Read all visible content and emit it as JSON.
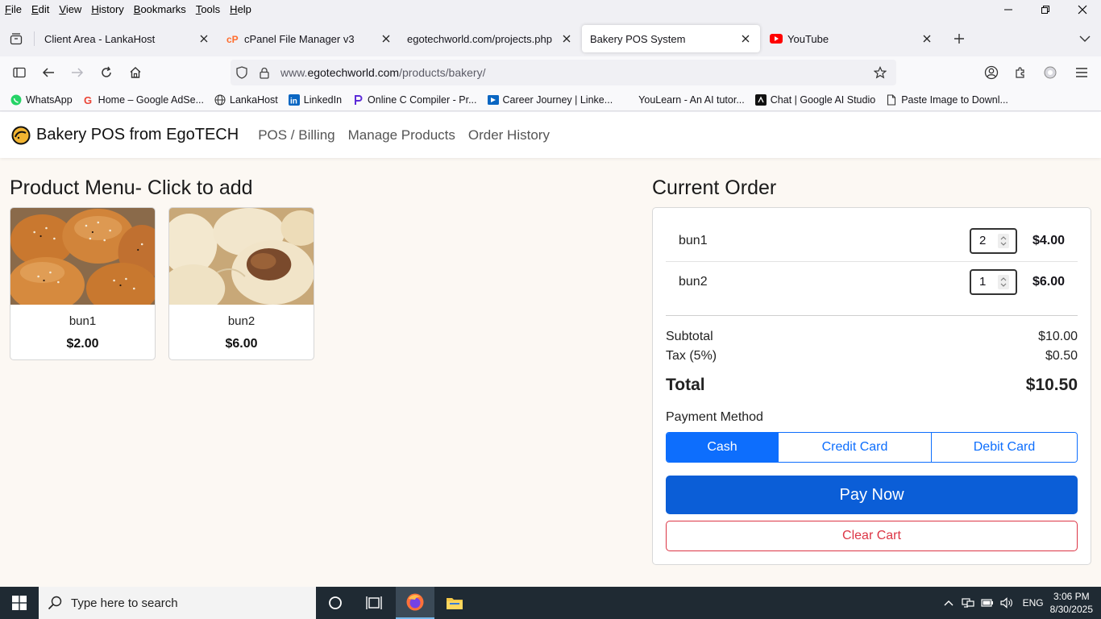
{
  "menubar": {
    "items": [
      "File",
      "Edit",
      "View",
      "History",
      "Bookmarks",
      "Tools",
      "Help"
    ],
    "underline": [
      "F",
      "E",
      "V",
      "H",
      "B",
      "T",
      "H"
    ]
  },
  "tabs": [
    {
      "title": "Client Area - LankaHost",
      "icon": "lankahost-icon"
    },
    {
      "title": "cPanel File Manager v3",
      "icon": "cpanel-icon"
    },
    {
      "title": "egotechworld.com/projects.php",
      "icon": ""
    },
    {
      "title": "Bakery POS System",
      "icon": "",
      "active": true
    },
    {
      "title": "YouTube",
      "icon": "youtube-icon"
    }
  ],
  "urlbar": {
    "prefix": "www.",
    "host": "egotechworld.com",
    "path": "/products/bakery/"
  },
  "bookmarks": [
    {
      "label": "WhatsApp",
      "icon": "whatsapp-icon"
    },
    {
      "label": "Home – Google AdSe...",
      "icon": "google-icon"
    },
    {
      "label": "LankaHost",
      "icon": "globe-icon"
    },
    {
      "label": "LinkedIn",
      "icon": "linkedin-icon"
    },
    {
      "label": "Online C Compiler - Pr...",
      "icon": "programiz-icon"
    },
    {
      "label": "Career Journey | Linke...",
      "icon": "career-icon"
    },
    {
      "label": "YouLearn - An AI tutor...",
      "icon": "youlearn-icon"
    },
    {
      "label": "Chat | Google AI Studio",
      "icon": "aistudio-icon"
    },
    {
      "label": "Paste Image to Downl...",
      "icon": "page-icon"
    }
  ],
  "app": {
    "brand": "Bakery POS from EgoTECH",
    "nav": [
      "POS / Billing",
      "Manage Products",
      "Order History"
    ],
    "menu_title": "Product Menu- Click to add",
    "products": [
      {
        "name": "bun1",
        "price": "$2.00"
      },
      {
        "name": "bun2",
        "price": "$6.00"
      }
    ],
    "order_title": "Current Order",
    "order_items": [
      {
        "name": "bun1",
        "qty": "2",
        "total": "$4.00"
      },
      {
        "name": "bun2",
        "qty": "1",
        "total": "$6.00"
      }
    ],
    "summary": {
      "subtotal_label": "Subtotal",
      "subtotal": "$10.00",
      "tax_label": "Tax (5%)",
      "tax": "$0.50",
      "total_label": "Total",
      "total": "$10.50"
    },
    "payment_label": "Payment Method",
    "payment_methods": [
      "Cash",
      "Credit Card",
      "Debit Card"
    ],
    "selected_payment": "Cash",
    "pay_now": "Pay Now",
    "clear_cart": "Clear Cart"
  },
  "taskbar": {
    "search_placeholder": "Type here to search",
    "lang": "ENG",
    "time": "3:06 PM",
    "date": "8/30/2025"
  },
  "colors": {
    "primary": "#0d6efd",
    "pay_now": "#0b5ed7",
    "danger": "#dc3545",
    "page_bg": "#fcf8f3"
  }
}
